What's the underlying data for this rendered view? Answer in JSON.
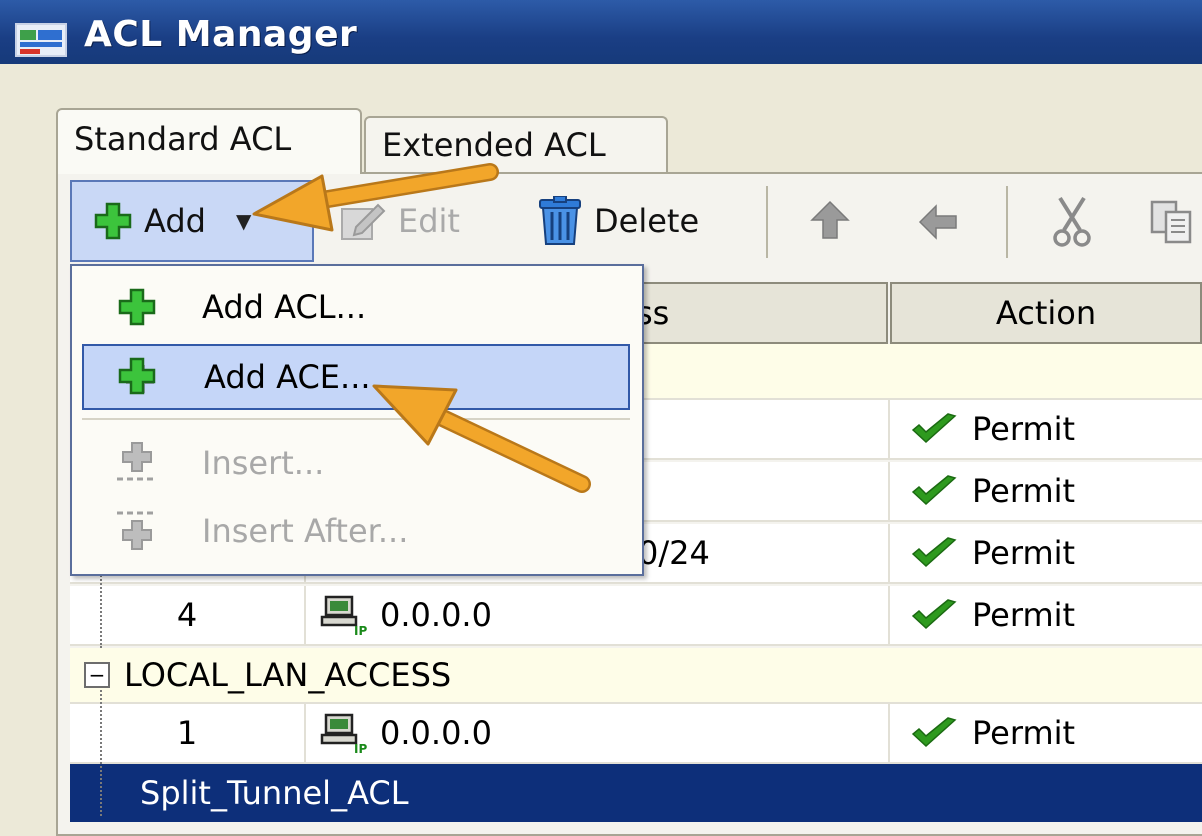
{
  "window": {
    "title": "ACL Manager"
  },
  "tabs": [
    {
      "label": "Standard ACL",
      "active": true
    },
    {
      "label": "Extended ACL",
      "active": false
    }
  ],
  "toolbar": {
    "add_label": "Add",
    "edit_label": "Edit",
    "delete_label": "Delete",
    "icons": [
      "plus-icon",
      "edit-icon",
      "trash-icon",
      "move-up-icon",
      "move-down-icon",
      "cut-icon",
      "copy-icon"
    ]
  },
  "add_menu": {
    "items": [
      {
        "label": "Add ACL...",
        "enabled": true,
        "highlighted": false
      },
      {
        "label": "Add ACE...",
        "enabled": true,
        "highlighted": true
      },
      {
        "label": "Insert...",
        "enabled": false,
        "highlighted": false
      },
      {
        "label": "Insert After...",
        "enabled": false,
        "highlighted": false
      }
    ]
  },
  "table": {
    "columns": {
      "address_partial": "ss",
      "action": "Action"
    },
    "rows_first_group": [
      {
        "no": "",
        "address": "",
        "action": "Permit"
      },
      {
        "no": "",
        "address": "",
        "action": "Permit"
      },
      {
        "no": "",
        "address": "0/24",
        "action": "Permit"
      },
      {
        "no": "4",
        "address": "0.0.0.0",
        "action": "Permit"
      }
    ],
    "groups": [
      {
        "name": "LOCAL_LAN_ACCESS",
        "rows": [
          {
            "no": "1",
            "address": "0.0.0.0",
            "action": "Permit"
          }
        ]
      },
      {
        "name": "Split_Tunnel_ACL",
        "selected": true
      }
    ]
  },
  "colors": {
    "title_bar": "#1a3e84",
    "selection": "#0d2f7a",
    "menu_highlight": "#c5d6f8",
    "permit_check": "#2e9a1e",
    "callout_arrow": "#f2a62a"
  }
}
